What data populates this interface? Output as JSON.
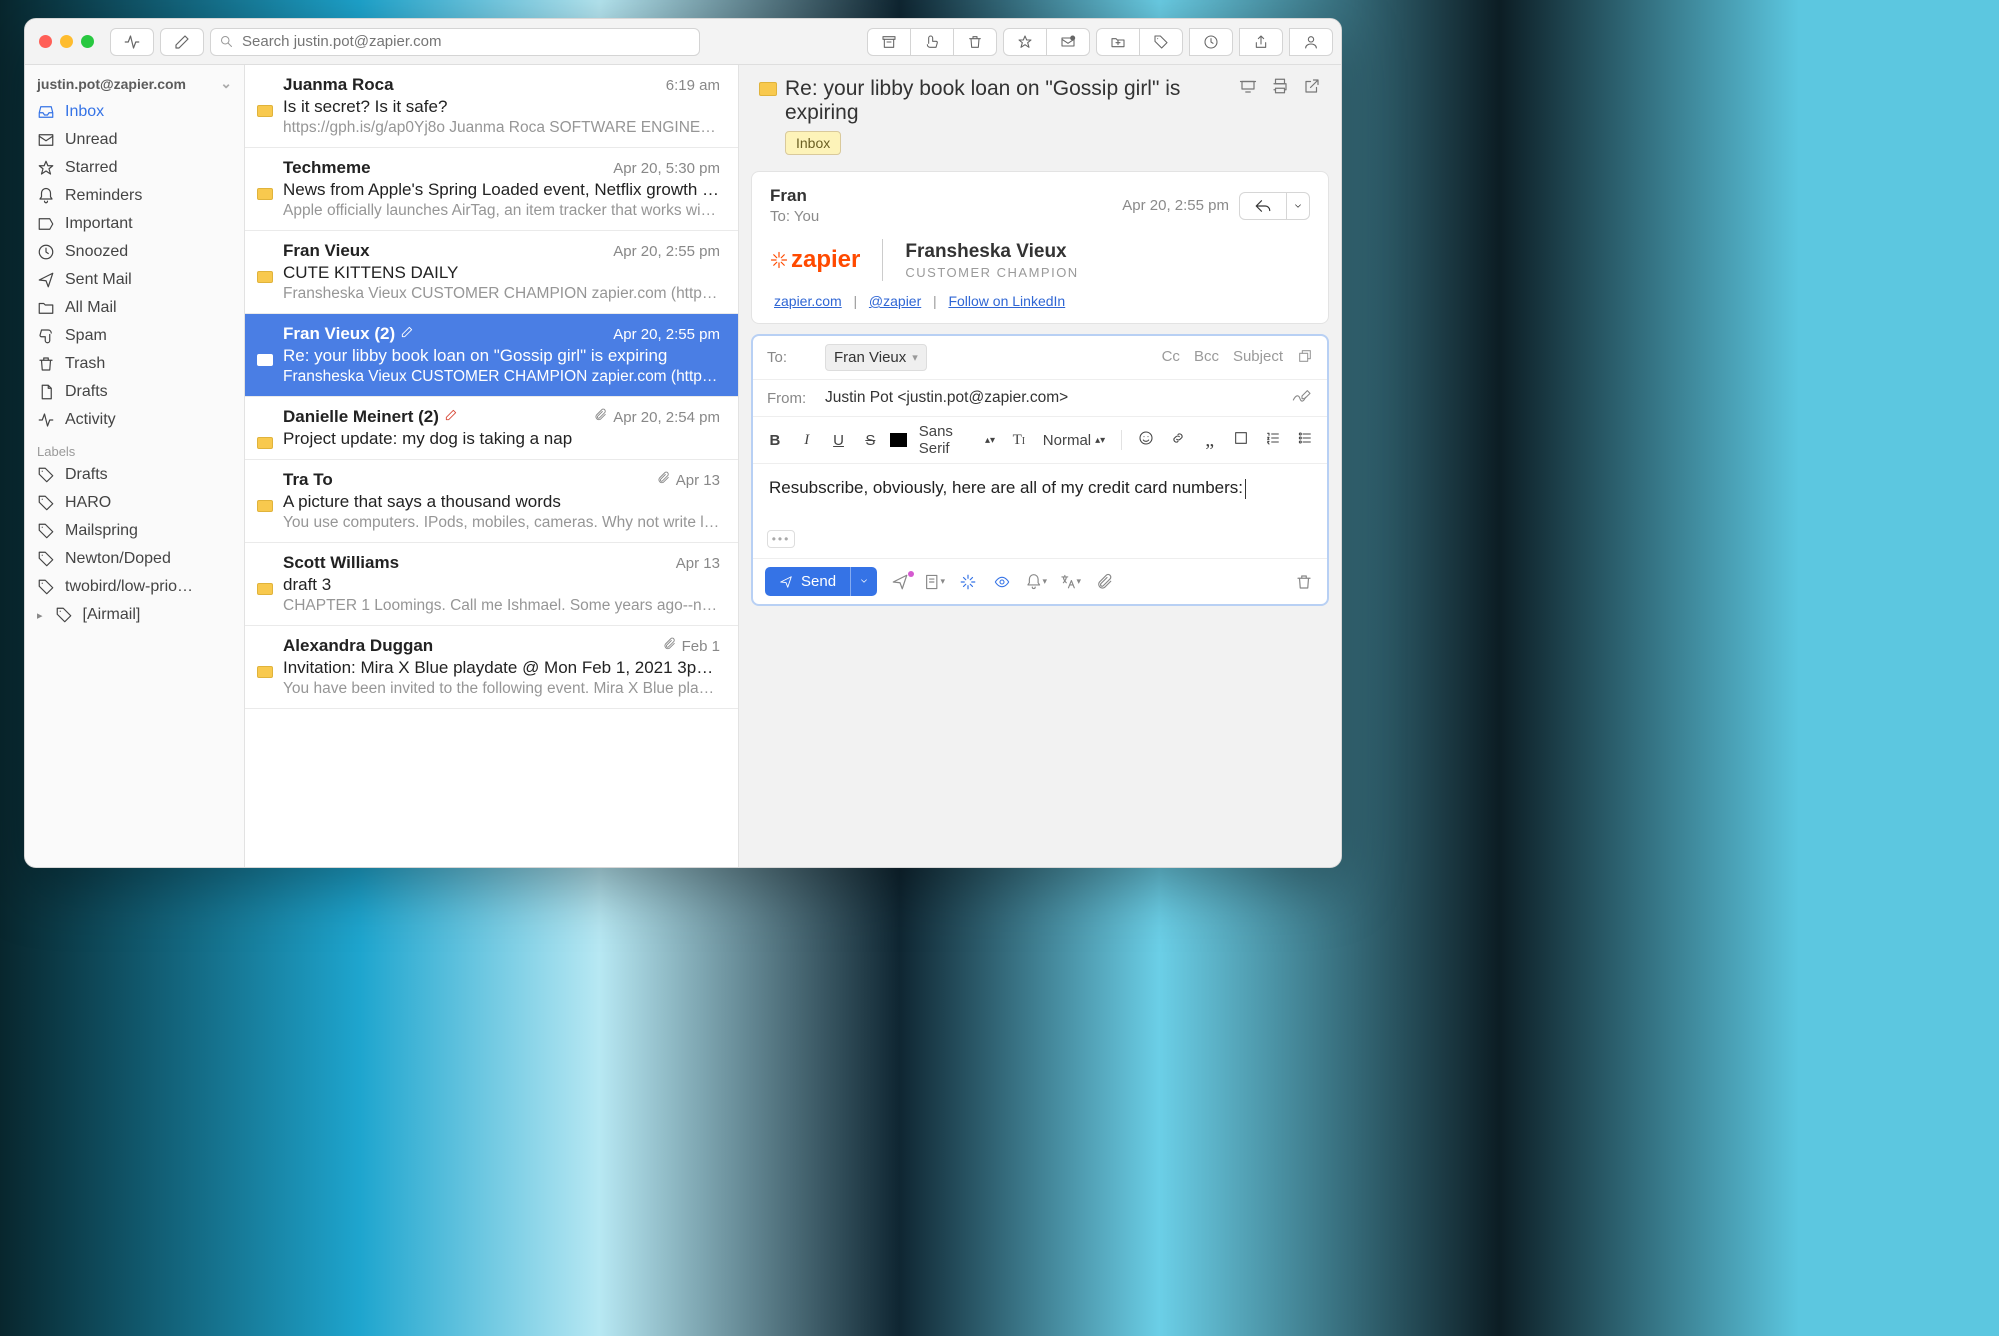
{
  "search": {
    "placeholder": "Search justin.pot@zapier.com"
  },
  "account": "justin.pot@zapier.com",
  "sidebar": {
    "items": [
      {
        "label": "Inbox",
        "selected": true,
        "icon": "inbox"
      },
      {
        "label": "Unread",
        "icon": "mail"
      },
      {
        "label": "Starred",
        "icon": "star"
      },
      {
        "label": "Reminders",
        "icon": "bell"
      },
      {
        "label": "Important",
        "icon": "bookmark"
      },
      {
        "label": "Snoozed",
        "icon": "clock"
      },
      {
        "label": "Sent Mail",
        "icon": "send"
      },
      {
        "label": "All Mail",
        "icon": "folder"
      },
      {
        "label": "Spam",
        "icon": "thumbs-down"
      },
      {
        "label": "Trash",
        "icon": "trash"
      },
      {
        "label": "Drafts",
        "icon": "file"
      },
      {
        "label": "Activity",
        "icon": "activity"
      }
    ],
    "labels_header": "Labels",
    "labels": [
      "Drafts",
      "HARO",
      "Mailspring",
      "Newton/Doped",
      "twobird/low-prio…",
      "[Airmail]"
    ]
  },
  "messages": [
    {
      "sender": "Juanma Roca",
      "time": "6:19 am",
      "subject": "Is it secret? Is it safe?",
      "snippet": "https://gph.is/g/ap0Yj8o Juanma Roca SOFTWARE ENGINEE…"
    },
    {
      "sender": "Techmeme",
      "time": "Apr 20, 5:30 pm",
      "subject": "News from Apple's Spring Loaded event, Netflix growth slo…",
      "snippet": "Apple officially launches AirTag, an item tracker that works wit…"
    },
    {
      "sender": "Fran Vieux",
      "time": "Apr 20, 2:55 pm",
      "subject": "CUTE KITTENS DAILY",
      "snippet": "Fransheska Vieux CUSTOMER CHAMPION zapier.com (https:…"
    },
    {
      "sender": "Fran Vieux (2)",
      "time": "Apr 20, 2:55 pm",
      "subject": "Re: your libby book loan on \"Gossip girl\" is expiring",
      "snippet": "Fransheska Vieux CUSTOMER CHAMPION zapier.com (https:…",
      "selected": true,
      "draft": true,
      "folder_white": true
    },
    {
      "sender": "Danielle Meinert (2)",
      "time": "Apr 20, 2:54 pm",
      "subject": "Project update: my dog is taking a nap",
      "snippet": "",
      "has_attach": true,
      "draft_red": true
    },
    {
      "sender": "Tra To",
      "time": "Apr 13",
      "subject": "A picture that says a thousand words",
      "snippet": "You use computers. IPods, mobiles, cameras. Why not write le…",
      "has_attach": true
    },
    {
      "sender": "Scott Williams",
      "time": "Apr 13",
      "subject": "draft 3",
      "snippet": "CHAPTER 1 Loomings. Call me Ishmael. Some years ago--ne…"
    },
    {
      "sender": "Alexandra Duggan",
      "time": "Feb 1",
      "subject": "Invitation: Mira X Blue playdate @ Mon Feb 1, 2021 3pm - …",
      "snippet": "You have been invited to the following event. Mira X Blue playd…",
      "has_attach": true
    }
  ],
  "detail": {
    "title": "Re: your libby book loan on \"Gossip girl\" is expiring",
    "badge": "Inbox",
    "from_name": "Fran",
    "from_date": "Apr 20, 2:55 pm",
    "to_line": "To: You",
    "sig_brand": "zapier",
    "sig_name": "Fransheska Vieux",
    "sig_role": "CUSTOMER CHAMPION",
    "sig_link_site": "zapier.com",
    "sig_link_twitter": "@zapier",
    "sig_link_linkedin": "Follow on LinkedIn"
  },
  "compose": {
    "to_label": "To:",
    "to_chip": "Fran Vieux",
    "cc": "Cc",
    "bcc": "Bcc",
    "subject": "Subject",
    "from_label": "From:",
    "from_value": "Justin Pot <justin.pot@zapier.com>",
    "font_family": "Sans Serif",
    "font_size": "Normal",
    "body": "Resubscribe, obviously, here are all of my credit card numbers:",
    "send_label": "Send"
  }
}
